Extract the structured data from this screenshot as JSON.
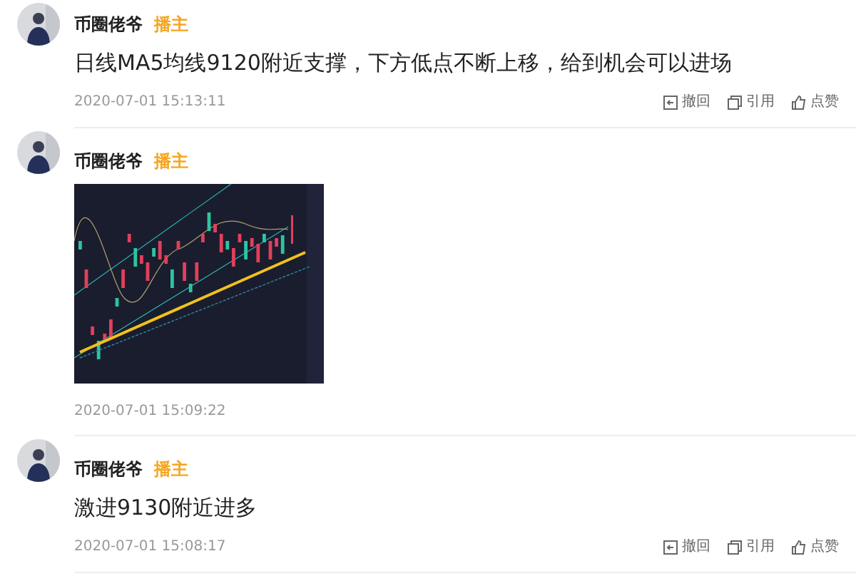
{
  "posts": [
    {
      "author": "币圈佬爷",
      "badge": "播主",
      "text": "日线MA5均线9120附近支撑，下方低点不断上移，给到机会可以进场",
      "time": "2020-07-01 15:13:11",
      "actions": [
        {
          "kind": "recall",
          "label": "撤回"
        },
        {
          "kind": "quote",
          "label": "引用"
        },
        {
          "kind": "like",
          "label": "点赞"
        }
      ]
    },
    {
      "author": "币圈佬爷",
      "badge": "播主",
      "image": {
        "kind": "chart"
      },
      "time": "2020-07-01 15:09:22"
    },
    {
      "author": "币圈佬爷",
      "badge": "播主",
      "text": "激进9130附近进多",
      "time": "2020-07-01 15:08:17",
      "actions": [
        {
          "kind": "recall",
          "label": "撤回"
        },
        {
          "kind": "quote",
          "label": "引用"
        },
        {
          "kind": "like",
          "label": "点赞"
        }
      ]
    }
  ]
}
